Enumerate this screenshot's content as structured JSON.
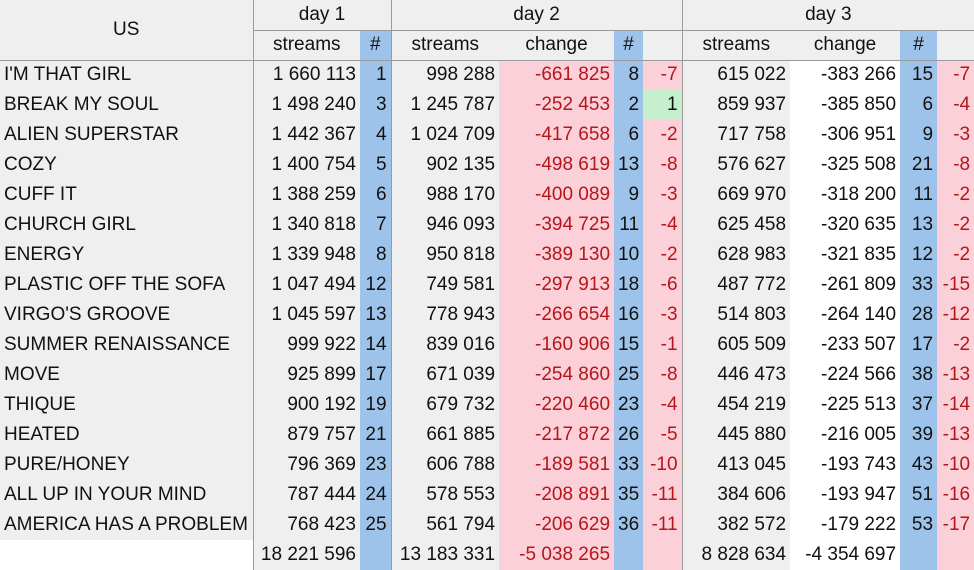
{
  "header": {
    "region": "US",
    "day1": "day 1",
    "day2": "day 2",
    "day3": "day 3",
    "streams": "streams",
    "rank": "#",
    "change": "change"
  },
  "rows": [
    {
      "song": "I'M THAT GIRL",
      "d1_streams": "1 660 113",
      "d1_rank": "1",
      "d2_streams": "998 288",
      "d2_change": "-661 825",
      "d2_rank": "8",
      "d2_move": "-7",
      "d3_streams": "615 022",
      "d3_change": "-383 266",
      "d3_rank": "15",
      "d3_move": "-7"
    },
    {
      "song": "BREAK MY SOUL",
      "d1_streams": "1 498 240",
      "d1_rank": "3",
      "d2_streams": "1 245 787",
      "d2_change": "-252 453",
      "d2_rank": "2",
      "d2_move": "1",
      "d3_streams": "859 937",
      "d3_change": "-385 850",
      "d3_rank": "6",
      "d3_move": "-4"
    },
    {
      "song": "ALIEN SUPERSTAR",
      "d1_streams": "1 442 367",
      "d1_rank": "4",
      "d2_streams": "1 024 709",
      "d2_change": "-417 658",
      "d2_rank": "6",
      "d2_move": "-2",
      "d3_streams": "717 758",
      "d3_change": "-306 951",
      "d3_rank": "9",
      "d3_move": "-3"
    },
    {
      "song": "COZY",
      "d1_streams": "1 400 754",
      "d1_rank": "5",
      "d2_streams": "902 135",
      "d2_change": "-498 619",
      "d2_rank": "13",
      "d2_move": "-8",
      "d3_streams": "576 627",
      "d3_change": "-325 508",
      "d3_rank": "21",
      "d3_move": "-8"
    },
    {
      "song": "CUFF IT",
      "d1_streams": "1 388 259",
      "d1_rank": "6",
      "d2_streams": "988 170",
      "d2_change": "-400 089",
      "d2_rank": "9",
      "d2_move": "-3",
      "d3_streams": "669 970",
      "d3_change": "-318 200",
      "d3_rank": "11",
      "d3_move": "-2"
    },
    {
      "song": "CHURCH GIRL",
      "d1_streams": "1 340 818",
      "d1_rank": "7",
      "d2_streams": "946 093",
      "d2_change": "-394 725",
      "d2_rank": "11",
      "d2_move": "-4",
      "d3_streams": "625 458",
      "d3_change": "-320 635",
      "d3_rank": "13",
      "d3_move": "-2"
    },
    {
      "song": "ENERGY",
      "d1_streams": "1 339 948",
      "d1_rank": "8",
      "d2_streams": "950 818",
      "d2_change": "-389 130",
      "d2_rank": "10",
      "d2_move": "-2",
      "d3_streams": "628 983",
      "d3_change": "-321 835",
      "d3_rank": "12",
      "d3_move": "-2"
    },
    {
      "song": "PLASTIC OFF THE SOFA",
      "d1_streams": "1 047 494",
      "d1_rank": "12",
      "d2_streams": "749 581",
      "d2_change": "-297 913",
      "d2_rank": "18",
      "d2_move": "-6",
      "d3_streams": "487 772",
      "d3_change": "-261 809",
      "d3_rank": "33",
      "d3_move": "-15"
    },
    {
      "song": "VIRGO'S GROOVE",
      "d1_streams": "1 045 597",
      "d1_rank": "13",
      "d2_streams": "778 943",
      "d2_change": "-266 654",
      "d2_rank": "16",
      "d2_move": "-3",
      "d3_streams": "514 803",
      "d3_change": "-264 140",
      "d3_rank": "28",
      "d3_move": "-12"
    },
    {
      "song": "SUMMER RENAISSANCE",
      "d1_streams": "999 922",
      "d1_rank": "14",
      "d2_streams": "839 016",
      "d2_change": "-160 906",
      "d2_rank": "15",
      "d2_move": "-1",
      "d3_streams": "605 509",
      "d3_change": "-233 507",
      "d3_rank": "17",
      "d3_move": "-2"
    },
    {
      "song": "MOVE",
      "d1_streams": "925 899",
      "d1_rank": "17",
      "d2_streams": "671 039",
      "d2_change": "-254 860",
      "d2_rank": "25",
      "d2_move": "-8",
      "d3_streams": "446 473",
      "d3_change": "-224 566",
      "d3_rank": "38",
      "d3_move": "-13"
    },
    {
      "song": "THIQUE",
      "d1_streams": "900 192",
      "d1_rank": "19",
      "d2_streams": "679 732",
      "d2_change": "-220 460",
      "d2_rank": "23",
      "d2_move": "-4",
      "d3_streams": "454 219",
      "d3_change": "-225 513",
      "d3_rank": "37",
      "d3_move": "-14"
    },
    {
      "song": "HEATED",
      "d1_streams": "879 757",
      "d1_rank": "21",
      "d2_streams": "661 885",
      "d2_change": "-217 872",
      "d2_rank": "26",
      "d2_move": "-5",
      "d3_streams": "445 880",
      "d3_change": "-216 005",
      "d3_rank": "39",
      "d3_move": "-13"
    },
    {
      "song": "PURE/HONEY",
      "d1_streams": "796 369",
      "d1_rank": "23",
      "d2_streams": "606 788",
      "d2_change": "-189 581",
      "d2_rank": "33",
      "d2_move": "-10",
      "d3_streams": "413 045",
      "d3_change": "-193 743",
      "d3_rank": "43",
      "d3_move": "-10"
    },
    {
      "song": "ALL UP IN YOUR MIND",
      "d1_streams": "787 444",
      "d1_rank": "24",
      "d2_streams": "578 553",
      "d2_change": "-208 891",
      "d2_rank": "35",
      "d2_move": "-11",
      "d3_streams": "384 606",
      "d3_change": "-193 947",
      "d3_rank": "51",
      "d3_move": "-16"
    },
    {
      "song": "AMERICA HAS A PROBLEM",
      "d1_streams": "768 423",
      "d1_rank": "25",
      "d2_streams": "561 794",
      "d2_change": "-206 629",
      "d2_rank": "36",
      "d2_move": "-11",
      "d3_streams": "382 572",
      "d3_change": "-179 222",
      "d3_rank": "53",
      "d3_move": "-17"
    }
  ],
  "totals": {
    "d1_streams": "18 221 596",
    "d2_streams": "13 183 331",
    "d2_change": "-5 038 265",
    "d3_streams": "8 828 634",
    "d3_change": "-4 354 697"
  },
  "colors": {
    "gray_cell": "#efefef",
    "rank_blue": "#9ec3ea",
    "change_pink": "#fcd0d8",
    "gain_green": "#c6efce",
    "negative_red": "#b4161b"
  }
}
